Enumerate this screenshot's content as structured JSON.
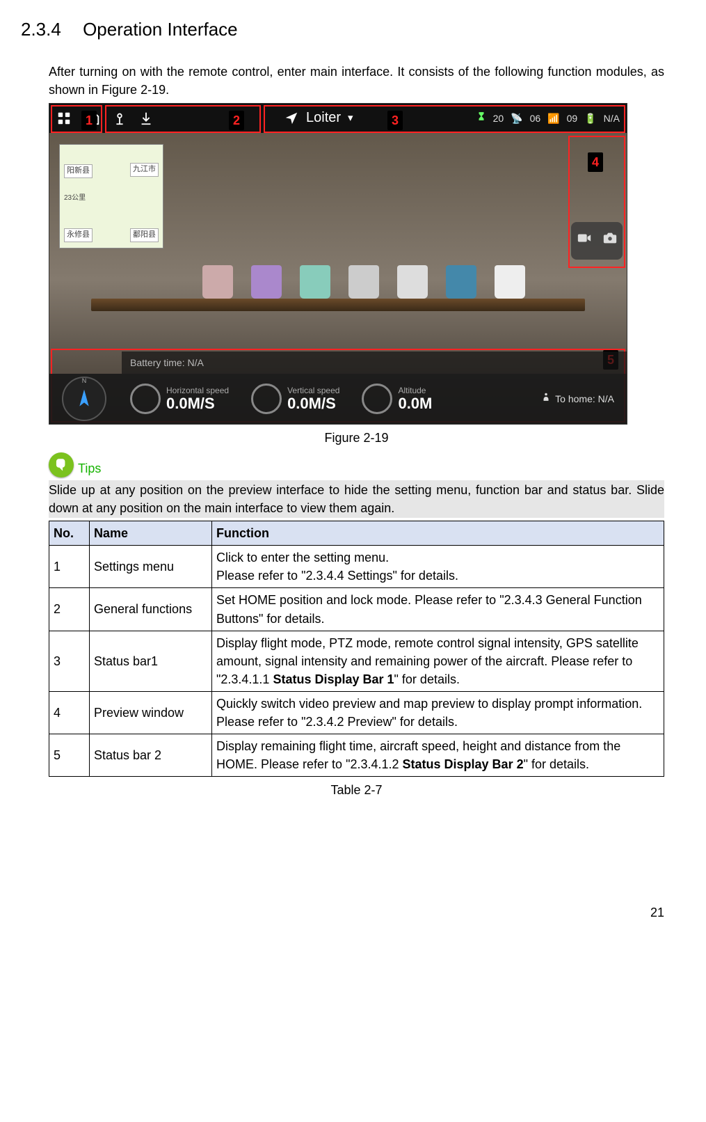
{
  "section": {
    "number": "2.3.4",
    "title": "Operation Interface"
  },
  "intro": "After turning on with the remote control, enter main interface. It consists of the following function modules, as shown in Figure 2-19.",
  "figure_caption": "Figure 2-19",
  "tips_label": "Tips",
  "tips_body": "Slide up at any position on the preview interface to hide the setting menu, function bar and status bar. Slide down at any position on the main interface to view them again.",
  "screenshot": {
    "flight_mode": "Loiter",
    "gps_count": "20",
    "signal": "06",
    "battery_pct": "09",
    "top_na": "N/A",
    "battery_time": "Battery time: N/A",
    "horizontal_label": "Horizontal speed",
    "horizontal_val": "0.0M/S",
    "vertical_label": "Vertical speed",
    "vertical_val": "0.0M/S",
    "altitude_label": "Altitude",
    "altitude_val": "0.0M",
    "to_home": "To home: N/A",
    "map_labels": {
      "a": "阳新县",
      "b": "九江市",
      "c": "永修县",
      "d": "鄱阳县",
      "dist": "23公里"
    },
    "markers": {
      "one": "1",
      "two": "2",
      "three": "3",
      "four": "4",
      "five": "5"
    }
  },
  "table": {
    "headers": {
      "no": "No.",
      "name": "Name",
      "func": "Function"
    },
    "rows": [
      {
        "no": "1",
        "name": "Settings menu",
        "func": "Click to enter the setting menu.\nPlease refer to \"2.3.4.4 Settings\" for details."
      },
      {
        "no": "2",
        "name": "General functions",
        "func": "Set HOME position and lock mode. Please refer to \"2.3.4.3 General Function Buttons\" for details."
      },
      {
        "no": "3",
        "name": "Status bar1",
        "func_pre": "Display flight mode, PTZ mode, remote control signal intensity, GPS satellite amount, signal intensity and remaining power of the aircraft. Please refer to \"2.3.4.1.1 ",
        "func_bold": "Status Display Bar 1",
        "func_post": "\" for details."
      },
      {
        "no": "4",
        "name": "Preview window",
        "func": "Quickly switch video preview and map preview to display prompt information. Please refer to \"2.3.4.2 Preview\" for details."
      },
      {
        "no": "5",
        "name": "Status bar 2",
        "func_pre": "Display remaining flight time, aircraft speed, height and distance from the HOME. Please refer to \"2.3.4.1.2 ",
        "func_bold": "Status Display Bar 2",
        "func_post": "\" for details."
      }
    ],
    "caption": "Table 2-7"
  },
  "page_number": "21"
}
